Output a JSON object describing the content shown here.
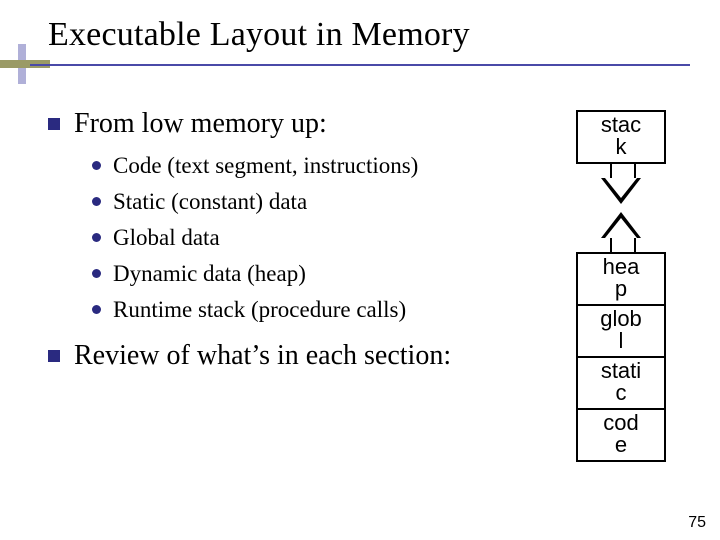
{
  "title": "Executable Layout in Memory",
  "bullets": [
    {
      "text": "From low memory up:",
      "sub": [
        "Code (text segment, instructions)",
        "Static (constant) data",
        "Global data",
        "Dynamic data (heap)",
        "Runtime stack (procedure calls)"
      ]
    },
    {
      "text": "Review of what’s in each section:",
      "sub": []
    }
  ],
  "memory": {
    "stack": "stac\nk",
    "heap": "hea\np",
    "global": "glob\nl",
    "static": "stati\nc",
    "code": "cod\ne"
  },
  "page_number": "75"
}
